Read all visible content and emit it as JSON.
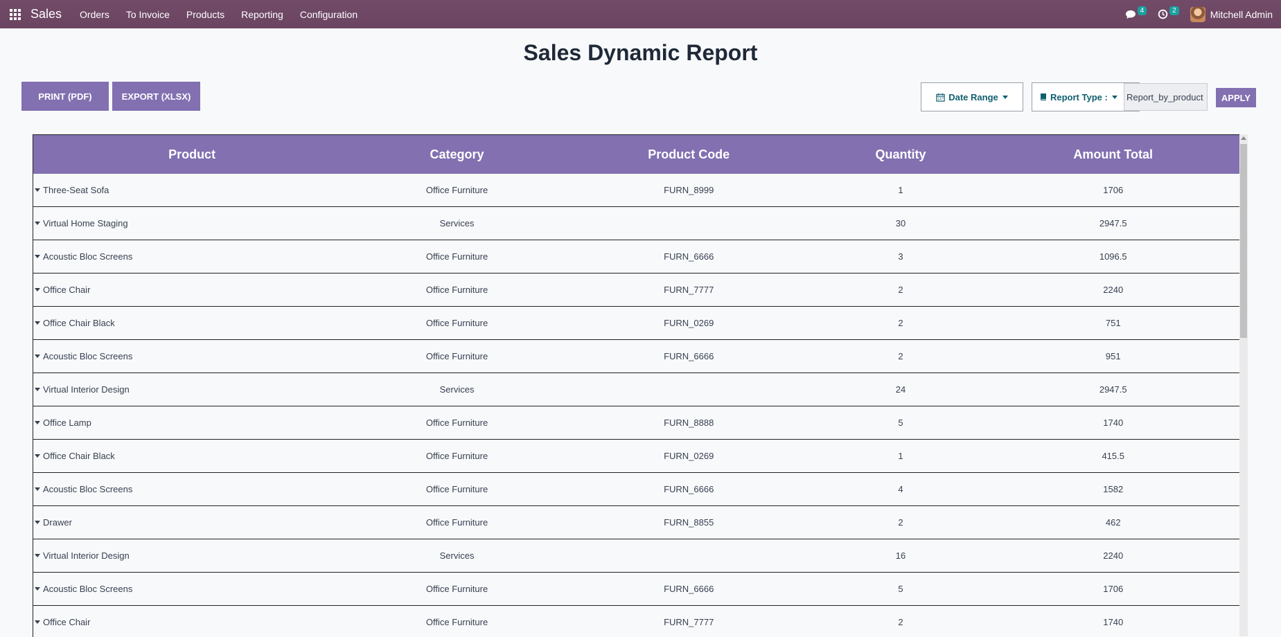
{
  "nav": {
    "brand": "Sales",
    "items": [
      "Orders",
      "To Invoice",
      "Products",
      "Reporting",
      "Configuration"
    ],
    "messages_count": "4",
    "activities_count": "2",
    "user_name": "Mitchell Admin"
  },
  "page": {
    "title": "Sales Dynamic Report",
    "print_label": "PRINT (PDF)",
    "export_label": "EXPORT (XLSX)",
    "date_range_label": "Date Range",
    "report_type_label": "Report Type :",
    "report_type_value": "Report_by_product",
    "apply_label": "APPLY"
  },
  "table": {
    "headers": [
      "Product",
      "Category",
      "Product Code",
      "Quantity",
      "Amount Total"
    ],
    "rows": [
      [
        "Three-Seat Sofa",
        "Office Furniture",
        "FURN_8999",
        "1",
        "1706"
      ],
      [
        "Virtual Home Staging",
        "Services",
        "",
        "30",
        "2947.5"
      ],
      [
        "Acoustic Bloc Screens",
        "Office Furniture",
        "FURN_6666",
        "3",
        "1096.5"
      ],
      [
        "Office Chair",
        "Office Furniture",
        "FURN_7777",
        "2",
        "2240"
      ],
      [
        "Office Chair Black",
        "Office Furniture",
        "FURN_0269",
        "2",
        "751"
      ],
      [
        "Acoustic Bloc Screens",
        "Office Furniture",
        "FURN_6666",
        "2",
        "951"
      ],
      [
        "Virtual Interior Design",
        "Services",
        "",
        "24",
        "2947.5"
      ],
      [
        "Office Lamp",
        "Office Furniture",
        "FURN_8888",
        "5",
        "1740"
      ],
      [
        "Office Chair Black",
        "Office Furniture",
        "FURN_0269",
        "1",
        "415.5"
      ],
      [
        "Acoustic Bloc Screens",
        "Office Furniture",
        "FURN_6666",
        "4",
        "1582"
      ],
      [
        "Drawer",
        "Office Furniture",
        "FURN_8855",
        "2",
        "462"
      ],
      [
        "Virtual Interior Design",
        "Services",
        "",
        "16",
        "2240"
      ],
      [
        "Acoustic Bloc Screens",
        "Office Furniture",
        "FURN_6666",
        "5",
        "1706"
      ],
      [
        "Office Chair",
        "Office Furniture",
        "FURN_7777",
        "2",
        "1740"
      ]
    ]
  },
  "colors": {
    "topbar": "#714b67",
    "accent": "#8270b1",
    "teal": "#0f5e6e"
  }
}
